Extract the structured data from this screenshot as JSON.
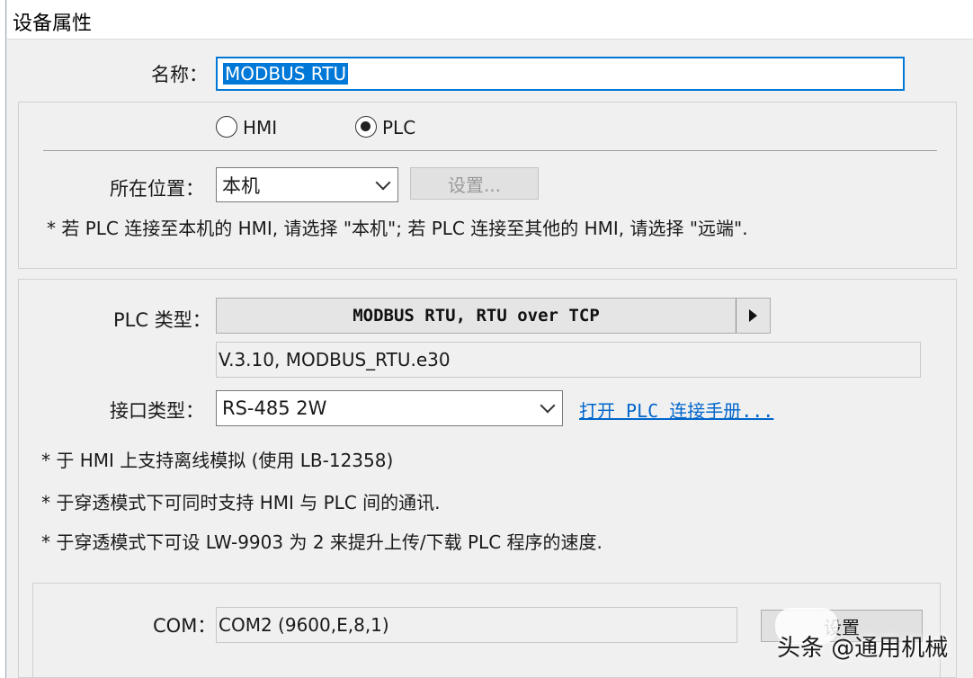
{
  "window": {
    "title": "设备属性"
  },
  "name_field": {
    "label": "名称：",
    "value": "MODBUS RTU"
  },
  "device_kind": {
    "options": [
      {
        "label": "HMI",
        "checked": false
      },
      {
        "label": "PLC",
        "checked": true
      }
    ]
  },
  "location": {
    "label": "所在位置：",
    "selected": "本机",
    "settings_button": "设置...",
    "note": "* 若 PLC 连接至本机的 HMI, 请选择 \"本机\"; 若 PLC 连接至其他的 HMI, 请选择 \"远端\"."
  },
  "plc_type": {
    "label": "PLC 类型：",
    "value": "MODBUS RTU, RTU over TCP",
    "version": "V.3.10, MODBUS_RTU.e30"
  },
  "interface_type": {
    "label": "接口类型：",
    "selected": "RS-485 2W",
    "manual_link": "打开 PLC 连接手册..."
  },
  "notes": [
    "* 于 HMI 上支持离线模拟 (使用 LB-12358)",
    "* 于穿透模式下可同时支持 HMI 与 PLC 间的通讯.",
    "* 于穿透模式下可设 LW-9903 为 2 来提升上传/下载 PLC 程序的速度."
  ],
  "com": {
    "label": "COM：",
    "value": "COM2 (9600,E,8,1)",
    "settings_button": "设置"
  },
  "watermark": {
    "text": "头条 @通用机械"
  }
}
